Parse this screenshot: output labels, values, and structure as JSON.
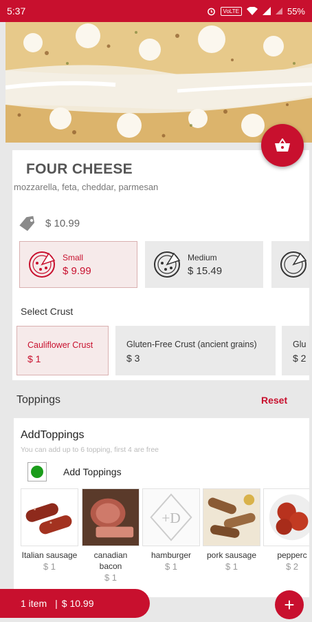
{
  "status_bar": {
    "time": "5:37",
    "network": "VoLTE",
    "battery": "55%"
  },
  "product": {
    "name": "FOUR CHEESE",
    "description": "mozzarella, feta, cheddar, parmesan",
    "base_price": "$ 10.99"
  },
  "sizes": [
    {
      "name": "Small",
      "price": "$ 9.99",
      "selected": true
    },
    {
      "name": "Medium",
      "price": "$ 15.49",
      "selected": false
    }
  ],
  "crust": {
    "title": "Select Crust",
    "options": [
      {
        "name": "Cauliflower Crust",
        "price": "$ 1",
        "selected": true
      },
      {
        "name": "Gluten-Free Crust (ancient grains)",
        "price": "$ 3",
        "selected": false
      },
      {
        "name": "Glu",
        "price": "$ 2",
        "selected": false
      }
    ]
  },
  "toppings": {
    "header": "Toppings",
    "reset": "Reset",
    "add_title": "AddToppings",
    "hint": "You can add up to 6 topping, first 4 are free",
    "toggle_label": "Add Toppings",
    "toggle_checked": true,
    "items": [
      {
        "name": "Italian sausage",
        "price": "$ 1"
      },
      {
        "name": "canadian bacon",
        "price": "$ 1"
      },
      {
        "name": "hamburger",
        "price": "$ 1"
      },
      {
        "name": "pork sausage",
        "price": "$ 1"
      },
      {
        "name": "pepperc",
        "price": "$ 2"
      }
    ]
  },
  "order": {
    "count": "1 item",
    "separator": "|",
    "total": "$ 10.99"
  },
  "colors": {
    "accent": "#c8102e",
    "checkbox_dot": "#1a9c1a"
  }
}
